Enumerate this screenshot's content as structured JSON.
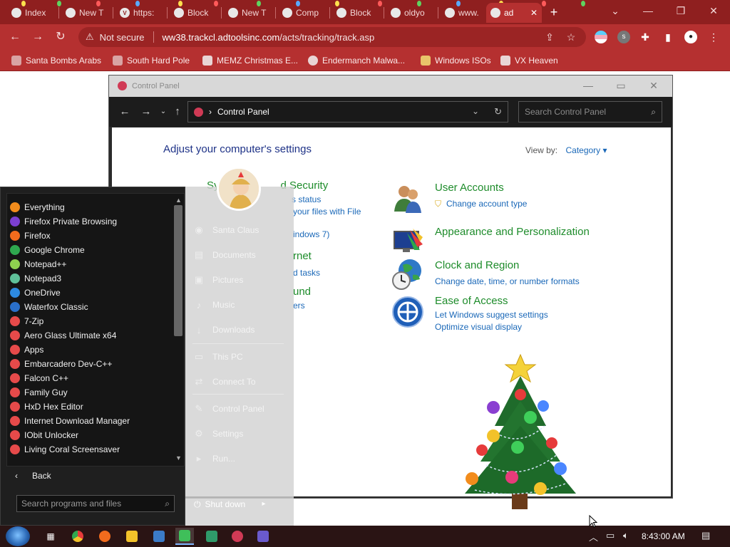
{
  "browser": {
    "tabs": [
      {
        "label": "Index"
      },
      {
        "label": "New T"
      },
      {
        "label": "https:"
      },
      {
        "label": "Block"
      },
      {
        "label": "New T"
      },
      {
        "label": "Comp"
      },
      {
        "label": "Block"
      },
      {
        "label": "oldyo"
      },
      {
        "label": "www."
      },
      {
        "label": "ad"
      }
    ],
    "new_tab": "+",
    "window_controls": {
      "menu": "⌄",
      "minimize": "—",
      "restore": "❐",
      "close": "✕"
    },
    "security_label": "Not secure",
    "url_host": "ww38.trackcl.adtoolsinc.com",
    "url_path": "/acts/tracking/track.asp",
    "bookmarks": [
      {
        "label": "Santa Bombs Arabs"
      },
      {
        "label": "South Hard Pole"
      },
      {
        "label": "MEMZ Christmas E..."
      },
      {
        "label": "Endermanch Malwa..."
      },
      {
        "label": "Windows ISOs"
      },
      {
        "label": "VX Heaven"
      }
    ]
  },
  "control_panel": {
    "window_title": "Control Panel",
    "breadcrumb": "Control Panel",
    "search_placeholder": "Search Control Panel",
    "heading": "Adjust your computer's settings",
    "view_by_label": "View by:",
    "view_by_value": "Category ▾",
    "left_fragments": {
      "system_security": "Sy",
      "system_security_tail": "d Security",
      "status": "s status",
      "file_history": "your files with File",
      "windows7": "indows 7)",
      "network": "rnet",
      "tasks": "d tasks",
      "sound": "und",
      "printers": "ers"
    },
    "categories": [
      {
        "title": "User Accounts",
        "links": [
          "Change account type"
        ]
      },
      {
        "title": "Appearance and Personalization",
        "links": []
      },
      {
        "title": "Clock and Region",
        "links": [
          "Change date, time, or number formats"
        ]
      },
      {
        "title": "Ease of Access",
        "links": [
          "Let Windows suggest settings",
          "Optimize visual display"
        ]
      }
    ]
  },
  "start_menu": {
    "programs": [
      {
        "label": "Everything",
        "color": "#f28c1c"
      },
      {
        "label": "Firefox Private Browsing",
        "color": "#7b3fd1"
      },
      {
        "label": "Firefox",
        "color": "#f26b1d"
      },
      {
        "label": "Google Chrome",
        "color": "#2fa84f"
      },
      {
        "label": "Notepad++",
        "color": "#8fd14f"
      },
      {
        "label": "Notepad3",
        "color": "#5fc19a"
      },
      {
        "label": "OneDrive",
        "color": "#2d8ae0"
      },
      {
        "label": "Waterfox Classic",
        "color": "#2a6fc9"
      },
      {
        "label": "7-Zip",
        "color": "#e64a4a"
      },
      {
        "label": "Aero Glass Ultimate x64",
        "color": "#e64a4a"
      },
      {
        "label": "Apps",
        "color": "#e64a4a"
      },
      {
        "label": "Embarcadero Dev-C++",
        "color": "#e64a4a"
      },
      {
        "label": "Falcon C++",
        "color": "#e64a4a"
      },
      {
        "label": "Family Guy",
        "color": "#e64a4a"
      },
      {
        "label": "HxD Hex Editor",
        "color": "#e64a4a"
      },
      {
        "label": "Internet Download Manager",
        "color": "#e64a4a"
      },
      {
        "label": "IObit Unlocker",
        "color": "#e64a4a"
      },
      {
        "label": "Living Coral Screensaver",
        "color": "#e64a4a"
      }
    ],
    "back_label": "Back",
    "search_placeholder": "Search programs and files",
    "places": [
      {
        "label": "Santa Claus",
        "icon": "user-icon",
        "glyph": "◉"
      },
      {
        "label": "Documents",
        "icon": "documents-icon",
        "glyph": "▤"
      },
      {
        "label": "Pictures",
        "icon": "pictures-icon",
        "glyph": "▣"
      },
      {
        "label": "Music",
        "icon": "music-icon",
        "glyph": "♪"
      },
      {
        "label": "Downloads",
        "icon": "downloads-icon",
        "glyph": "↓"
      },
      {
        "label": "This PC",
        "icon": "computer-icon",
        "glyph": "▭"
      },
      {
        "label": "Connect To",
        "icon": "network-icon",
        "glyph": "⇄"
      },
      {
        "label": "Control Panel",
        "icon": "control-panel-icon",
        "glyph": "✎"
      },
      {
        "label": "Settings",
        "icon": "settings-icon",
        "glyph": "⚙"
      },
      {
        "label": "Run...",
        "icon": "run-icon",
        "glyph": "▸"
      }
    ],
    "shutdown_label": "Shut down",
    "shutdown_arrow": "▸"
  },
  "taskbar": {
    "clock": "8:43:00 AM"
  },
  "colors": {
    "browser_frame": "#8f1f1f",
    "browser_toolbar": "#b53030",
    "cp_category_green": "#1e8c2b",
    "cp_link_blue": "#1a68b8",
    "cp_heading_blue": "#1e3287"
  }
}
